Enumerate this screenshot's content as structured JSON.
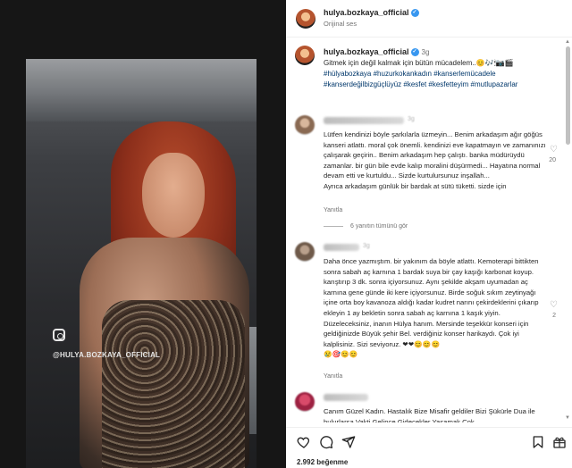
{
  "media": {
    "watermark_handle": "@HULYA.BOZKAYA_OFFICIAL"
  },
  "header": {
    "username": "hulya.bozkaya_official",
    "audio": "Orijinal ses",
    "verified_mark": "✓"
  },
  "caption": {
    "username": "hulya.bozkaya_official",
    "time": "3g",
    "text": "Gitmek için değil kalmak için bütün mücadelem..😊🎶🕯📷🎬",
    "hashtags": "#hülyabozkaya #huzurkokankadın #kanserlemücadele #kanserdeğilbizgüçlüyüz #kesfet #kesfetteyim #mutlupazarlar"
  },
  "comments": [
    {
      "time": "3g",
      "text": "Lütfen kendinizi böyle şarkılarla üzmeyin... Benim arkadaşım ağır göğüs kanseri atlattı. moral çok önemli. kendinizi eve kapatmayın ve zamanınızı çalışarak geçirin.. Benim arkadaşım hep çalıştı. banka müdürüydü zamanlar. bir gün bile evde kalıp moralini düşürmedi... Hayatına normal devam etti ve kurtuldu... Sizde kurtulursunuz inşallah...",
      "text2": "Ayrıca arkadaşım günlük bir bardak at sütü tüketti. sizde için",
      "reply_label": "Yanıtla",
      "likes": "20",
      "view_replies": "6 yanıtın tümünü gör"
    },
    {
      "time": "3g",
      "text": "Daha önce yazmıştım. bir yakınım da böyle atlattı. Kemoterapi bittikten sonra sabah aç karnına 1 bardak suya bir çay kaşığı karbonat koyup. karıştırıp 3 dk. sonra içiyorsunuz. Aynı şekilde akşam uyumadan aç karnına gene günde iki kere içiyorsunuz. Birde soğuk sıkım zeytinyağı içine orta boy kavanoza aldığı kadar kudret narını çekirdeklerini çıkarıp ekleyin 1 ay bekletin sonra sabah aç karnına 1 kaşık yiyin. Düzeleceksiniz, inanın Hülya hanım. Mersinde teşekkür konseri için geldiğinizde Büyük şehir Bel. verdiğiniz konser harikaydı. Çok iyi kalplisiniz. Sizi seviyoruz. ❤❤😊😊😊",
      "emoji_line": "😢🎯😊😊",
      "reply_label": "Yanıtla",
      "likes": "2"
    },
    {
      "text": "Canım Güzel Kadın. Hastalık Bize Misafir geldiler Bizi Şükürle Dua ile bulurlarsa Vakti Gelince Gidecekler Yasamak Çok"
    }
  ],
  "footer": {
    "likes_text": "2.992 beğenme"
  },
  "colors": {
    "link": "#00376b",
    "verified": "#3897f0",
    "heart": "#e0245e"
  }
}
